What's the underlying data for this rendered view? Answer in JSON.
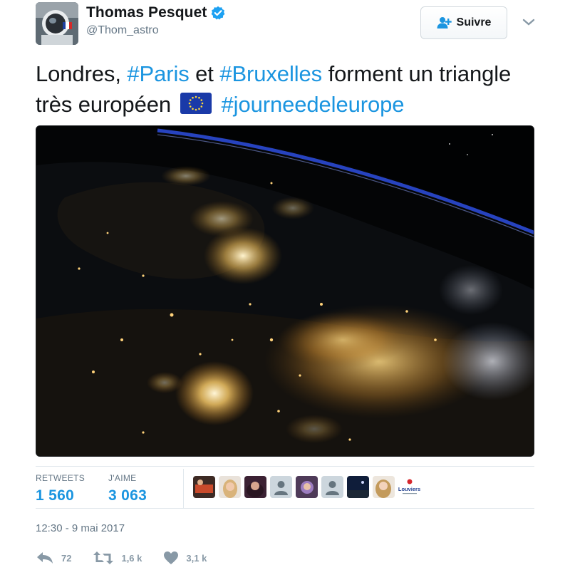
{
  "user": {
    "display_name": "Thomas Pesquet",
    "handle": "@Thom_astro",
    "avatar_icon": "astronaut-avatar",
    "verified_icon": "verified-badge-icon"
  },
  "follow": {
    "label": "Suivre",
    "icon": "add-user-icon"
  },
  "menu_icon": "chevron-down-icon",
  "tweet": {
    "segments": {
      "t1": "Londres, ",
      "h1": "#Paris",
      "t2": " et ",
      "h2": "#Bruxelles",
      "t3": " forment un triangle très européen",
      "flag_icon": "eu-flag-emoji",
      "h3": "#journeedeleurope"
    }
  },
  "media": {
    "description_icon": "night-earth-from-space-photo"
  },
  "stats": {
    "retweets_label": "RETWEETS",
    "retweets_value": "1 560",
    "likes_label": "J'AIME",
    "likes_value": "3 063"
  },
  "likers": [
    {
      "name": "liker-1",
      "kind": "photo"
    },
    {
      "name": "liker-2",
      "kind": "photo"
    },
    {
      "name": "liker-3",
      "kind": "photo"
    },
    {
      "name": "liker-4",
      "kind": "default-egg"
    },
    {
      "name": "liker-5",
      "kind": "photo"
    },
    {
      "name": "liker-6",
      "kind": "default-egg"
    },
    {
      "name": "liker-7",
      "kind": "photo"
    },
    {
      "name": "liker-8",
      "kind": "photo"
    },
    {
      "name": "liker-9",
      "kind": "logo",
      "text": "Louviers"
    }
  ],
  "timestamp": "12:30 - 9 mai 2017",
  "actions": {
    "reply_count": "72",
    "retweet_count": "1,6 k",
    "like_count": "3,1 k"
  },
  "colors": {
    "link": "#1b95e0",
    "muted": "#657786",
    "action": "#8899a6",
    "border": "#e1e8ed"
  }
}
